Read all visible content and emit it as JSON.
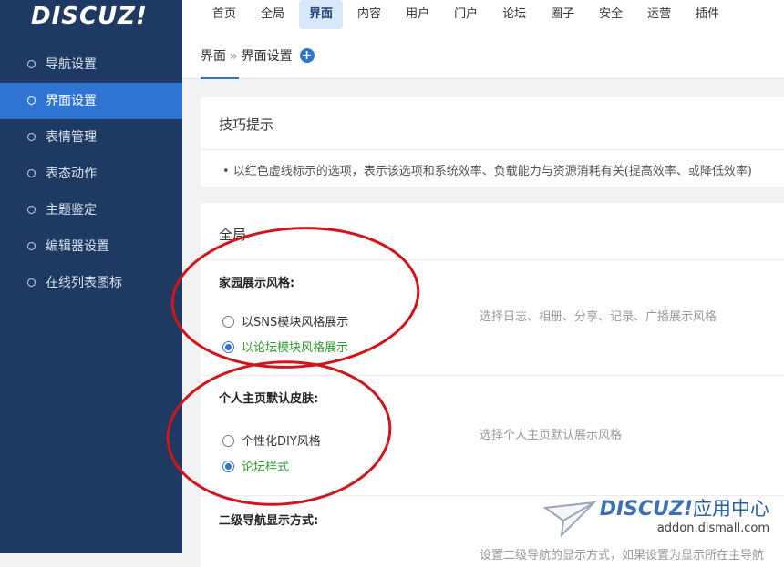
{
  "brand": {
    "logo_text": "DISCUZ!"
  },
  "sidebar": {
    "items": [
      {
        "label": "导航设置",
        "active": false
      },
      {
        "label": "界面设置",
        "active": true
      },
      {
        "label": "表情管理",
        "active": false
      },
      {
        "label": "表态动作",
        "active": false
      },
      {
        "label": "主题鉴定",
        "active": false
      },
      {
        "label": "编辑器设置",
        "active": false
      },
      {
        "label": "在线列表图标",
        "active": false
      }
    ]
  },
  "topmenu": {
    "items": [
      {
        "label": "首页",
        "active": false
      },
      {
        "label": "全局",
        "active": false
      },
      {
        "label": "界面",
        "active": true
      },
      {
        "label": "内容",
        "active": false
      },
      {
        "label": "用户",
        "active": false
      },
      {
        "label": "门户",
        "active": false
      },
      {
        "label": "论坛",
        "active": false
      },
      {
        "label": "圈子",
        "active": false
      },
      {
        "label": "安全",
        "active": false
      },
      {
        "label": "运营",
        "active": false
      },
      {
        "label": "插件",
        "active": false
      }
    ]
  },
  "breadcrumb": {
    "root": "界面",
    "separator": "»",
    "current": "界面设置",
    "add_icon": "plus-circle-icon"
  },
  "tips": {
    "title": "技巧提示",
    "text": "•  以红色虚线标示的选项，表示该选项和系统效率、负载能力与资源消耗有关(提高效率、或降低效率)"
  },
  "global": {
    "title": "全局",
    "settings": [
      {
        "label": "家园展示风格:",
        "description": "选择日志、相册、分享、记录、广播展示风格",
        "options": [
          {
            "label": "以SNS模块风格展示",
            "checked": false
          },
          {
            "label": "以论坛模块风格展示",
            "checked": true
          }
        ]
      },
      {
        "label": "个人主页默认皮肤:",
        "description": "选择个人主页默认展示风格",
        "options": [
          {
            "label": "个性化DIY风格",
            "checked": false
          },
          {
            "label": "论坛样式",
            "checked": true
          }
        ]
      },
      {
        "label": "二级导航显示方式:",
        "description": "设置二级导航的显示方式，如果设置为显示所在主导航"
      }
    ]
  },
  "watermark": {
    "logo": "DISCUZ!",
    "logo_cn": "应用中心",
    "url": "addon.dismall.com"
  },
  "colors": {
    "sidebar_bg": "#1e3a62",
    "accent": "#2f74d0",
    "checked_text": "#2f9a2f",
    "annotation": "#d0161b"
  }
}
